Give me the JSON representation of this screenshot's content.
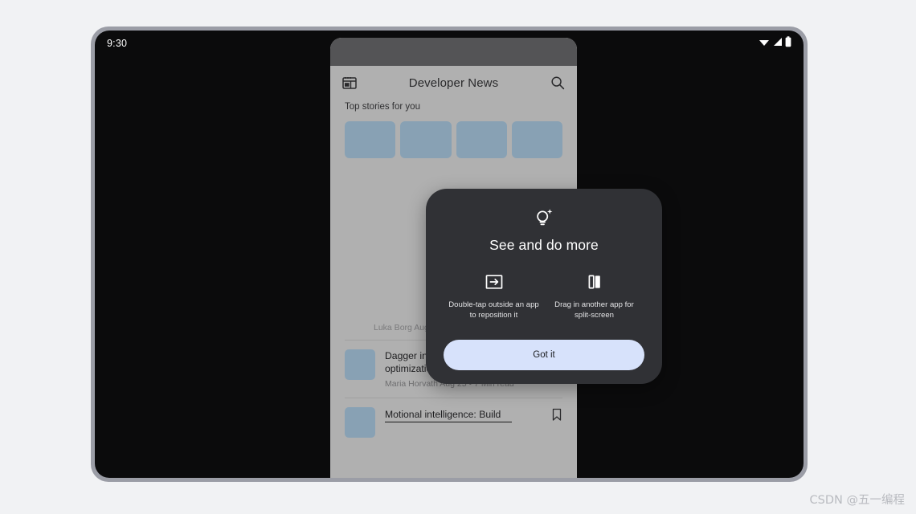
{
  "system": {
    "status_time": "9:30",
    "status_icons": [
      "wifi-icon",
      "signal-icon",
      "battery-icon"
    ]
  },
  "app": {
    "window_title": "Developer News",
    "caption_bar": "window-caption-handle",
    "leading_icon": "dashboard-layout-icon",
    "trailing_icon": "search-icon",
    "section_label": "Top stories for you",
    "thumbnails": [
      {
        "name": "story-thumbnail-1"
      },
      {
        "name": "story-thumbnail-2"
      },
      {
        "name": "story-thumbnail-3"
      },
      {
        "name": "story-thumbnail-4"
      }
    ],
    "orphan_meta": "Luka Borg   Aug 26 • 4 Min read",
    "articles": [
      {
        "title": "Dagger in Kotlin: Gotchas and optimizations",
        "meta": "Maria Horvath   Aug 25 • 7 Min read",
        "bookmark_icon": "bookmark-icon",
        "underlined": false
      },
      {
        "title": "Motional intelligence: Build",
        "meta": "",
        "bookmark_icon": "bookmark-icon",
        "underlined": true
      }
    ]
  },
  "dialog": {
    "hero_icon": "lightbulb-sparkle-icon",
    "title": "See and do more",
    "features": [
      {
        "icon": "reposition-window-icon",
        "text": "Double-tap outside an app to reposition it"
      },
      {
        "icon": "split-screen-icon",
        "text": "Drag in another app for split-screen"
      }
    ],
    "cta_label": "Got it"
  },
  "watermark": {
    "text": "CSDN @五一编程"
  },
  "colors": {
    "page_background": "#f1f2f4",
    "device_bezel": "#9b9da6",
    "screen": "#0b0b0c",
    "app_surface": "#b0b0b0",
    "caption_bar": "#545456",
    "thumbnail": "#88a1b4",
    "dialog_surface": "#303135",
    "cta_background": "#d7e2fb"
  }
}
